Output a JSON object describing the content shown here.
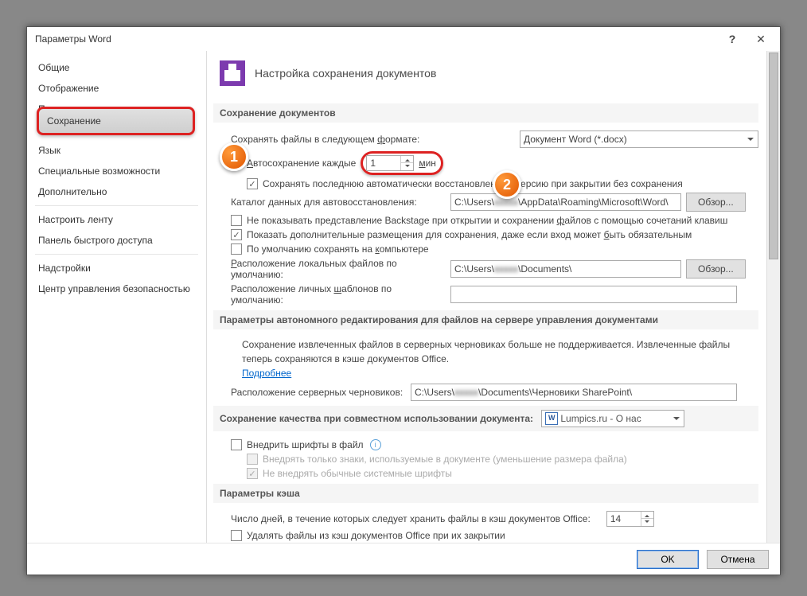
{
  "window": {
    "title": "Параметры Word"
  },
  "sidebar": {
    "items": [
      {
        "label": "Общие"
      },
      {
        "label": "Отображение"
      },
      {
        "label": "Правописание"
      },
      {
        "label": "Сохранение",
        "selected": true
      },
      {
        "label": "Язык"
      },
      {
        "label": "Специальные возможности"
      },
      {
        "label": "Дополнительно"
      },
      {
        "label": "Настроить ленту"
      },
      {
        "label": "Панель быстрого доступа"
      },
      {
        "label": "Надстройки"
      },
      {
        "label": "Центр управления безопасностью"
      }
    ]
  },
  "header": {
    "title": "Настройка сохранения документов"
  },
  "sec_docs": {
    "title": "Сохранение документов",
    "format_label_a": "Сохранять файлы в следующем ",
    "format_label_b": "ф",
    "format_label_c": "ормате:",
    "format_value": "Документ Word (*.docx)",
    "autosave_a": "А",
    "autosave_b": "втосохранение каждые",
    "autosave_value": "1",
    "autosave_unit_a": "м",
    "autosave_unit_b": "ин",
    "keep_last": "Сохранять последнюю автоматически восстановленную версию при закрытии без сохранения",
    "autorecover_label": "Каталог данных для автовосстановления:",
    "autorecover_path_a": "C:\\Users\\",
    "autorecover_path_b": "\\AppData\\Roaming\\Microsoft\\Word\\",
    "browse": "Обзор...",
    "no_backstage_a": "Не показывать представление Backstage при открытии и сохранении ",
    "no_backstage_b": "ф",
    "no_backstage_c": "айлов с помощью сочетаний клавиш",
    "show_additional_a": "Показать дополнительные размещения для сохранения, даже если вход может ",
    "show_additional_b": "б",
    "show_additional_c": "ыть обязательным",
    "default_pc_a": "По умолчанию сохранять на ",
    "default_pc_b": "к",
    "default_pc_c": "омпьютере",
    "local_loc_a": "Р",
    "local_loc_b": "асположение локальных файлов по умолчанию:",
    "local_loc_path_a": "C:\\Users\\",
    "local_loc_path_b": "\\Documents\\",
    "tmpl_loc_a": "Расположение личных ",
    "tmpl_loc_b": "ш",
    "tmpl_loc_c": "аблонов по умолчанию:"
  },
  "sec_offline": {
    "title": "Параметры автономного редактирования для файлов на сервере управления документами",
    "note": "Сохранение извлеченных файлов в серверных черновиках больше не поддерживается. Извлеченные файлы теперь сохраняются в кэше документов Office.",
    "more": "Подробнее",
    "drafts_label": "Расположение серверных черновиков:",
    "drafts_path_a": "C:\\Users\\",
    "drafts_path_b": "\\Documents\\Черновики SharePoint\\"
  },
  "sec_quality": {
    "title": "Сохранение качества при совместном использовании документа:",
    "doc_value": "Lumpics.ru - О нас",
    "embed": "Внедрить шрифты в файл",
    "embed_used": "Внедрять только знаки, используемые в документе (уменьшение размера файла)",
    "embed_sys": "Не внедрять обычные системные шрифты"
  },
  "sec_cache": {
    "title": "Параметры кэша",
    "days_label": "Число дней, в течение которых следует хранить файлы в кэш документов Office:",
    "days_value": "14",
    "del_label": "Удалять файлы из кэш документов Office при их закрытии"
  },
  "callouts": {
    "c1": "1",
    "c2": "2"
  },
  "footer": {
    "ok": "OK",
    "cancel": "Отмена"
  }
}
